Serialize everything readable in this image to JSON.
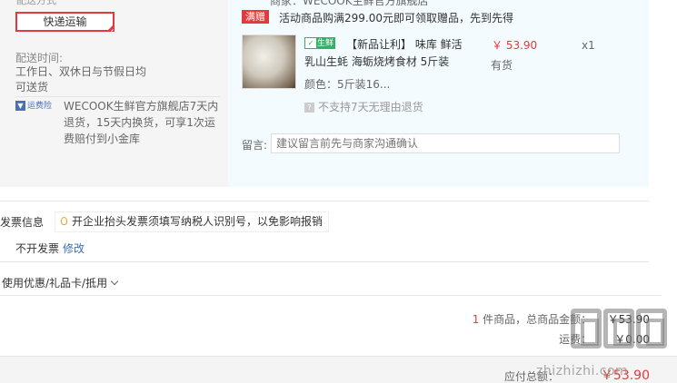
{
  "left": {
    "cut_label": "配送方式",
    "shipping_button": "快递运输",
    "delivery_title": "配送时间:",
    "delivery_line1": "工作日、双休日与节假日均",
    "delivery_line2": "可送货",
    "yfx_badge": "运费险",
    "policy": "WECOOK生鲜官方旗舰店7天内退货，15天内换货，可享1次运费赔付到小金库"
  },
  "right": {
    "shop_cut": "商家：WECOOK生鲜官方旗舰店",
    "gift_tag": "满赠",
    "gift_text": "活动商品购满299.00元即可领取赠品，先到先得",
    "fresh_badge": "生鲜",
    "product_name1": "【新品让利】 味库 鲜活",
    "product_name2": "乳山生蚝 海蛎烧烤食材 5斤装",
    "price": "￥ 53.90",
    "qty": "x1",
    "stock": "有货",
    "color": "颜色：5斤装16...",
    "no_return": "不支持7天无理由退货",
    "message_label": "留言:",
    "message_placeholder": "建议留言前先与商家沟通确认"
  },
  "invoice": {
    "title": "发票信息",
    "tip": "开企业抬头发票须填写纳税人识别号，以免影响报销",
    "status": "不开发票",
    "edit": "修改"
  },
  "coupon": {
    "label": "使用优惠/礼品卡/抵用"
  },
  "summary": {
    "count": "1",
    "count_suffix": "件商品，总商品金额：",
    "total": "￥53.90",
    "freight_label": "运费：",
    "freight": "￥0.00"
  },
  "footer": {
    "pay_label": "应付总额：",
    "pay_value": "￥53.90"
  },
  "watermark": {
    "text": "zhizhizhi.com"
  }
}
